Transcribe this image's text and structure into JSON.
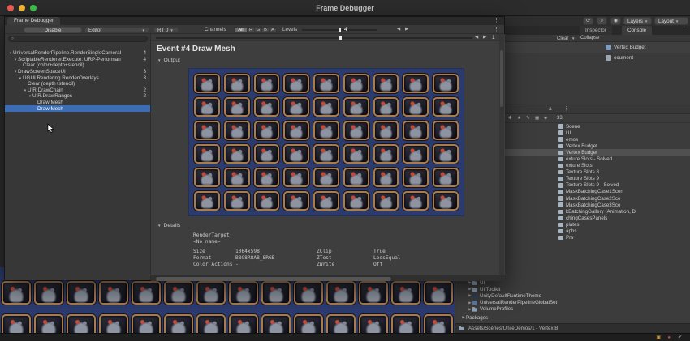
{
  "titlebar": {
    "title": "Frame Debugger"
  },
  "window": {
    "tab": "Frame Debugger",
    "toolbar": {
      "disable": "Disable",
      "editor": "Editor",
      "rt": "RT 0",
      "channels_label": "Channels",
      "channels": [
        "All",
        "R",
        "G",
        "B",
        "A"
      ],
      "levels_label": "Levels",
      "event_value": "4",
      "scrub_value": "1"
    },
    "tree": [
      {
        "label": "UniversalRenderPipeline.RenderSingleCameraI",
        "count": "4",
        "depth": 0,
        "arrow": "▼"
      },
      {
        "label": "ScriptableRenderer.Execute: URP-Performan",
        "count": "4",
        "depth": 1,
        "arrow": "▼"
      },
      {
        "label": "Clear (color+depth+stencil)",
        "count": "",
        "depth": 2,
        "arrow": ""
      },
      {
        "label": "DrawScreenSpaceUI",
        "count": "3",
        "depth": 1,
        "arrow": "▼"
      },
      {
        "label": "UGUI.Rendering.RenderOverlays",
        "count": "3",
        "depth": 2,
        "arrow": "▼"
      },
      {
        "label": "Clear (depth+stencil)",
        "count": "",
        "depth": 3,
        "arrow": ""
      },
      {
        "label": "UIR.DrawChain",
        "count": "2",
        "depth": 3,
        "arrow": "▼"
      },
      {
        "label": "UIR.DrawRanges",
        "count": "2",
        "depth": 4,
        "arrow": "▼"
      },
      {
        "label": "Draw Mesh",
        "count": "",
        "depth": 5,
        "arrow": "",
        "selected": false
      },
      {
        "label": "Draw Mesh",
        "count": "",
        "depth": 5,
        "arrow": "",
        "selected": true
      }
    ],
    "event_title": "Event #4 Draw Mesh",
    "output_label": "Output",
    "preview": {
      "cols": 9,
      "rows": 6
    },
    "details_label": "Details",
    "details": {
      "target_label": "RenderTarget",
      "target_name": "<No name>",
      "rows": [
        {
          "k1": "Size",
          "v1": "1064x598",
          "k2": "ZClip",
          "v2": "True"
        },
        {
          "k1": "Format",
          "v1": "B8G8R8A8_SRGB",
          "k2": "ZTest",
          "v2": "LessEqual"
        },
        {
          "k1": "Color Actions",
          "v1": "-",
          "k2": "ZWrite",
          "v2": "Off"
        }
      ]
    }
  },
  "editor": {
    "toolbar": {
      "icons": [
        {
          "name": "history",
          "glyph": "⟳"
        },
        {
          "name": "search",
          "glyph": "⌕"
        },
        {
          "name": "account",
          "glyph": "◉"
        }
      ],
      "layers": "Layers",
      "layout": "Layout"
    },
    "tabs": [
      {
        "label": "Inspector",
        "active": false
      },
      {
        "label": "Console",
        "active": true
      }
    ],
    "console": {
      "clear": "Clear",
      "collapse": "Collapse",
      "entries": [
        {
          "label": "Vertex Budget",
          "icon": "cube"
        },
        {
          "label": "ocument",
          "icon": "document"
        }
      ]
    },
    "project": {
      "header_glyph": "a",
      "count_badge": "33",
      "fav_icons": [
        {
          "name": "add",
          "glyph": "✚"
        },
        {
          "name": "star",
          "glyph": "★"
        },
        {
          "name": "edit",
          "glyph": "✎"
        },
        {
          "name": "grid",
          "glyph": "▦"
        },
        {
          "name": "filter",
          "glyph": "◈"
        }
      ],
      "items": [
        "Scene",
        "UI",
        "emos",
        "Vertex Budget",
        "Vertex Budget",
        "exture Slots - Solved",
        "exture Slots",
        "Texture Slots 8",
        "Texture Slots 9",
        "Texture Slots 9 - Solved",
        "MaskBatchingCase1Scen",
        "MaskBatchingCase2Sce",
        "MaskBatchingCase3Sce",
        "kBatchingGallery (Animation, D",
        "chingCasesPanels",
        "plates",
        "aphs",
        "Prs"
      ],
      "selected_index": 4,
      "lower_items": [
        {
          "label": "UI",
          "icon": "folder"
        },
        {
          "label": "UI Toolkit",
          "icon": "folder"
        },
        {
          "label": "UnityDefaultRuntimeTheme",
          "icon": "theme"
        },
        {
          "label": "UniversalRenderPipelineGlobalSet",
          "icon": "asset"
        },
        {
          "label": "VolumeProfiles",
          "icon": "folder"
        }
      ],
      "packages_label": "Packages"
    },
    "statusbar": {
      "path": "Assets/Scenes/UnileDemos/1 - Vertex B"
    },
    "status_icons": [
      {
        "name": "bake",
        "glyph": "▣",
        "color": "#d49a3b"
      },
      {
        "name": "alert",
        "glyph": "●",
        "color": "#bf5148"
      },
      {
        "name": "activity-check",
        "glyph": "✔",
        "color": "#9aa0a5"
      }
    ]
  },
  "gameview": {
    "cols": 14
  },
  "colors": {
    "selection": "#3c6cb4",
    "preview_bg": "#2c3b6e",
    "sprite_frame": "#a87c4f"
  }
}
